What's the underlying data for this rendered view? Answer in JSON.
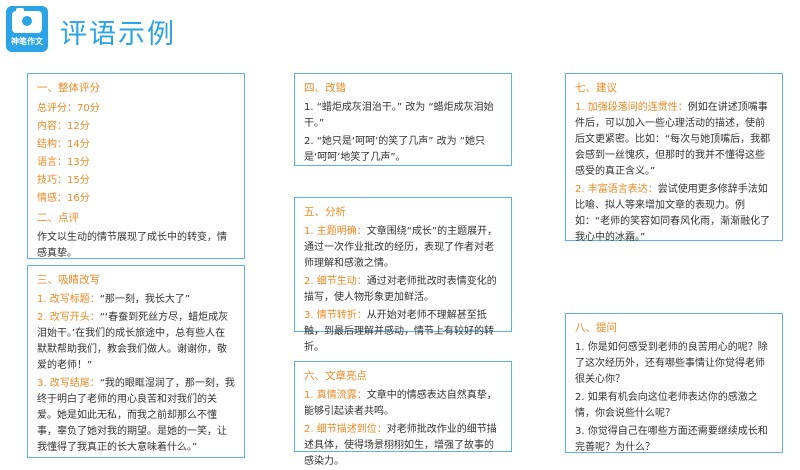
{
  "header": {
    "logo_text": "神笔作文",
    "title": "评语示例"
  },
  "box1": {
    "title": "一、整体评分",
    "scores": [
      {
        "label": "总评分：",
        "value": "70分"
      },
      {
        "label": "内容：",
        "value": "12分"
      },
      {
        "label": "结构：",
        "value": "14分"
      },
      {
        "label": "语言：",
        "value": "13分"
      },
      {
        "label": "技巧：",
        "value": "15分"
      },
      {
        "label": "情感：",
        "value": "16分"
      }
    ],
    "comment_title": "二、点评",
    "comment": "作文以生动的情节展现了成长中的转变，情感真挚。"
  },
  "box3": {
    "title": "三、吸睛改写",
    "items": [
      {
        "head": "1. 改写标题：",
        "text": "“那一刻，我长大了”"
      },
      {
        "head": "2. 改写开头：",
        "text": "“‘春蚕到死丝方尽，蜡炬成灰泪始干。’在我们的成长旅途中，总有些人在默默帮助我们，教会我们做人。谢谢你，敬爱的老师！”"
      },
      {
        "head": "3. 改写结尾：",
        "text": "“我的眼眶湿润了，那一刻，我终于明白了老师的用心良苦和对我们的关爱。她是如此无私，而我之前却那么不懂事，辜负了她对我的期望。是她的一笑，让我懂得了我真正的长大意味着什么。”"
      }
    ]
  },
  "box4": {
    "title": "四、改错",
    "items": [
      {
        "num": "1.",
        "text": "“蜡炬成灰泪治干。” 改为 “蜡炬成灰泪始干。”"
      },
      {
        "num": "2.",
        "text": "“她只是‘呵呵’的笑了几声” 改为 “她只是‘呵呵’地笑了几声”。"
      }
    ]
  },
  "box5": {
    "title": "五、分析",
    "items": [
      {
        "head": "1. 主题明确：",
        "text": "文章围绕“成长”的主题展开，通过一次作业批改的经历，表现了作者对老师理解和感激之情。"
      },
      {
        "head": "2. 细节生动：",
        "text": "通过对老师批改时表情变化的描写，使人物形象更加鲜活。"
      },
      {
        "head": "3. 情节转折：",
        "text": "从开始对老师不理解甚至抵触，到最后理解并感动，情节上有较好的转折。"
      }
    ]
  },
  "box6": {
    "title": "六、文章亮点",
    "items": [
      {
        "head": "1. 真情流露：",
        "text": "文章中的情感表达自然真挚，能够引起读者共鸣。"
      },
      {
        "head": "2. 细节描述到位：",
        "text": "对老师批改作业的细节描述具体，使得场景栩栩如生，增强了故事的感染力。"
      }
    ]
  },
  "box7": {
    "title": "七、建议",
    "items": [
      {
        "head": "1. 加强段落间的连贯性：",
        "text": "例如在讲述顶嘴事件后，可以加入一些心理活动的描述，使前后文更紧密。比如：“每次与她顶嘴后，我都会感到一丝愧疚，但那时的我并不懂得这些感受的真正含义。”"
      },
      {
        "head": "2. 丰富语言表达：",
        "text": "尝试使用更多修辞手法如比喻、拟人等来增加文章的表现力。例如：“老师的笑容如同春风化雨，渐渐融化了我心中的冰霜。”"
      }
    ]
  },
  "box8": {
    "title": "八、提问",
    "items": [
      {
        "num": "1.",
        "text": "你是如何感受到老师的良苦用心的呢？除了这次经历外，还有哪些事情让你觉得老师很关心你？"
      },
      {
        "num": "2.",
        "text": "如果有机会向这位老师表达你的感激之情，你会说些什么呢？"
      },
      {
        "num": "3.",
        "text": "你觉得自己在哪些方面还需要继续成长和完善呢？为什么？"
      }
    ]
  },
  "colors": {
    "accent_blue": "#2aa4e6",
    "accent_orange": "#f08a24",
    "border": "#5ab4e6"
  }
}
